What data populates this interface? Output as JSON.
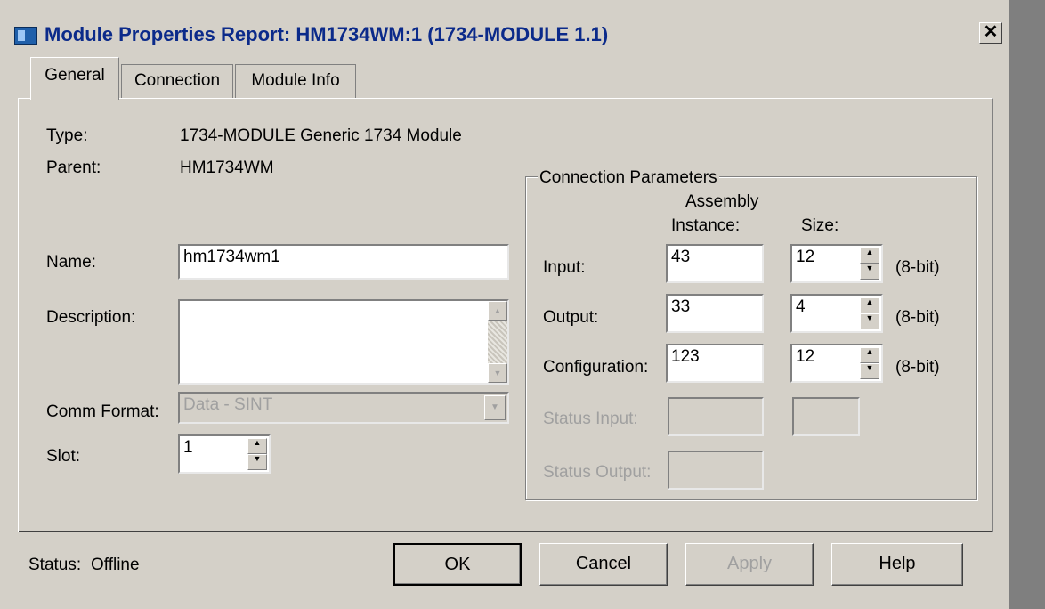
{
  "window": {
    "title": "Module Properties Report: HM1734WM:1 (1734-MODULE 1.1)",
    "close_label": "✕"
  },
  "tabs": [
    {
      "label": "General",
      "active": true
    },
    {
      "label": "Connection",
      "active": false
    },
    {
      "label": "Module Info",
      "active": false
    }
  ],
  "general": {
    "type_label": "Type:",
    "type_value": "1734-MODULE Generic 1734 Module",
    "parent_label": "Parent:",
    "parent_value": "HM1734WM",
    "name_label": "Name:",
    "name_value": "hm1734wm1",
    "description_label": "Description:",
    "description_value": "",
    "comm_format_label": "Comm Format:",
    "comm_format_value": "Data - SINT",
    "slot_label": "Slot:",
    "slot_value": "1"
  },
  "connection_parameters": {
    "title": "Connection Parameters",
    "header_assembly_1": "Assembly",
    "header_assembly_2": "Instance:",
    "header_size": "Size:",
    "input_label": "Input:",
    "input_instance": "43",
    "input_size": "12",
    "input_unit": "(8-bit)",
    "output_label": "Output:",
    "output_instance": "33",
    "output_size": "4",
    "output_unit": "(8-bit)",
    "config_label": "Configuration:",
    "config_instance": "123",
    "config_size": "12",
    "config_unit": "(8-bit)",
    "status_input_label": "Status Input:",
    "status_output_label": "Status Output:"
  },
  "footer": {
    "status_label": "Status:",
    "status_value": "Offline",
    "ok": "OK",
    "cancel": "Cancel",
    "apply": "Apply",
    "help": "Help"
  },
  "colors": {
    "title_text": "#0b2a8a",
    "dialog_bg": "#d4d0c8",
    "disabled_text": "#a0a0a0"
  }
}
